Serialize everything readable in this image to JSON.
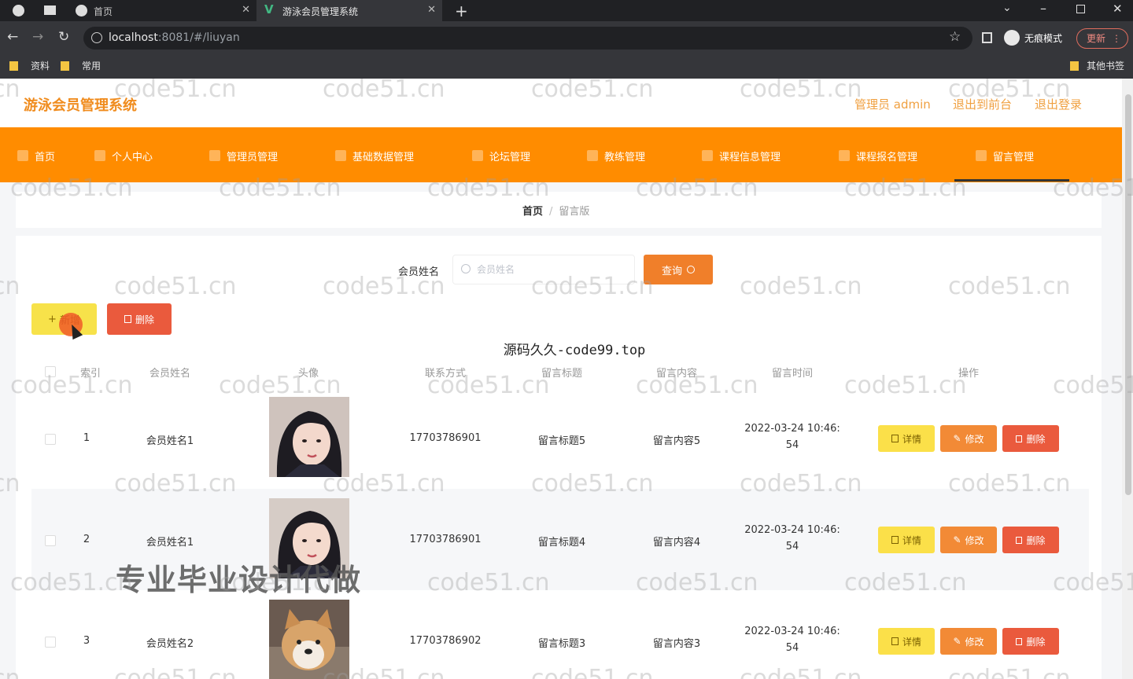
{
  "browser": {
    "tabs": [
      {
        "title": "首页"
      },
      {
        "title": "游泳会员管理系统"
      }
    ],
    "url_host": "localhost",
    "url_rest": ":8081/#/liuyan",
    "incognito_label": "无痕模式",
    "update_label": "更新",
    "bookmarks": [
      "资料",
      "常用"
    ],
    "other_bookmarks": "其他书签"
  },
  "header": {
    "brand": "游泳会员管理系统",
    "admin_label": "管理员 admin",
    "front_label": "退出到前台",
    "logout_label": "退出登录"
  },
  "nav": {
    "items": [
      {
        "label": "首页"
      },
      {
        "label": "个人中心"
      },
      {
        "label": "管理员管理"
      },
      {
        "label": "基础数据管理"
      },
      {
        "label": "论坛管理"
      },
      {
        "label": "教练管理"
      },
      {
        "label": "课程信息管理"
      },
      {
        "label": "课程报名管理"
      },
      {
        "label": "留言管理"
      }
    ]
  },
  "breadcrumb": {
    "home": "首页",
    "separator": "/",
    "current": "留言版"
  },
  "search": {
    "label": "会员姓名",
    "placeholder": "会员姓名",
    "query_label": "查询"
  },
  "toolbar": {
    "add_label": "新增",
    "delete_label": "删除"
  },
  "overlay_title": "源码久久-code99.top",
  "table": {
    "headers": [
      "索引",
      "会员姓名",
      "头像",
      "联系方式",
      "留言标题",
      "留言内容",
      "留言时间",
      "操作"
    ],
    "rows": [
      {
        "index": "1",
        "name": "会员姓名1",
        "phone": "17703786901",
        "title": "留言标题5",
        "content": "留言内容5",
        "time_line1": "2022-03-24 10:46:",
        "time_line2": "54"
      },
      {
        "index": "2",
        "name": "会员姓名1",
        "phone": "17703786901",
        "title": "留言标题4",
        "content": "留言内容4",
        "time_line1": "2022-03-24 10:46:",
        "time_line2": "54"
      },
      {
        "index": "3",
        "name": "会员姓名2",
        "phone": "17703786902",
        "title": "留言标题3",
        "content": "留言内容3",
        "time_line1": "2022-03-24 10:46:",
        "time_line2": "54"
      }
    ],
    "actions": {
      "detail": "详情",
      "edit": "修改",
      "delete": "删除"
    }
  },
  "promo_text": "专业毕业设计代做",
  "watermark_text": "code51.cn",
  "colors": {
    "nav_bg": "#ff8c00",
    "brand": "#f08c1e",
    "detail_btn": "#fbe049",
    "edit_btn": "#f28a36",
    "delete_btn": "#ea5a3d"
  }
}
